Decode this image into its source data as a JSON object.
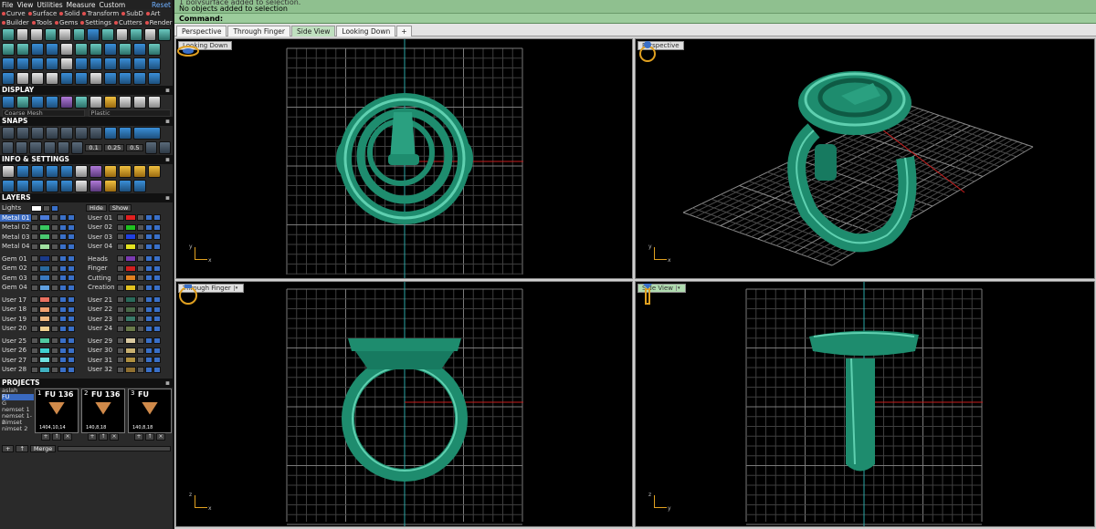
{
  "menu": [
    "File",
    "View",
    "Utilities",
    "Measure",
    "Custom"
  ],
  "menu_reset": "Reset",
  "categories": [
    "Curve",
    "Surface",
    "Solid",
    "Transform",
    "SubD",
    "Art",
    "Builder",
    "Tools",
    "Gems",
    "Settings",
    "Cutters",
    "Render"
  ],
  "sections": {
    "display": "DISPLAY",
    "snaps": "SNAPS",
    "info": "INFO & SETTINGS",
    "layers": "LAYERS",
    "projects": "PROJECTS"
  },
  "display_sub": [
    "Coarse Mesh",
    "Plastic"
  ],
  "snap_values": [
    "0.1",
    "0.25",
    "0.5"
  ],
  "layers": {
    "lights": "Lights",
    "hide": "Hide",
    "show": "Show",
    "left": [
      [
        {
          "name": "Metal 01",
          "color": "#4a7ad8",
          "sel": true
        },
        {
          "name": "Metal 02",
          "color": "#38c860"
        },
        {
          "name": "Metal 03",
          "color": "#4ac870"
        },
        {
          "name": "Metal 04",
          "color": "#a0e0a0"
        }
      ],
      [
        {
          "name": "Gem 01",
          "color": "#1a3a8a"
        },
        {
          "name": "Gem 02",
          "color": "#2a6aa0"
        },
        {
          "name": "Gem 03",
          "color": "#3a7ac0"
        },
        {
          "name": "Gem 04",
          "color": "#60a0e0"
        }
      ],
      [
        {
          "name": "User 17",
          "color": "#e87060"
        },
        {
          "name": "User 18",
          "color": "#f0a070"
        },
        {
          "name": "User 19",
          "color": "#f0b880"
        },
        {
          "name": "User 20",
          "color": "#f0d090"
        }
      ],
      [
        {
          "name": "User 25",
          "color": "#50c8a0"
        },
        {
          "name": "User 26",
          "color": "#40d0d0"
        },
        {
          "name": "User 27",
          "color": "#70e0e0"
        },
        {
          "name": "User 28",
          "color": "#40b0c0"
        }
      ]
    ],
    "right": [
      [
        {
          "name": "User 01",
          "color": "#e02020"
        },
        {
          "name": "User 02",
          "color": "#20c020"
        },
        {
          "name": "User 03",
          "color": "#2040e0"
        },
        {
          "name": "User 04",
          "color": "#e0e020"
        }
      ],
      [
        {
          "name": "Heads",
          "color": "#7a3ab0"
        },
        {
          "name": "Finger",
          "color": "#d02020"
        },
        {
          "name": "Cutting",
          "color": "#e08020"
        },
        {
          "name": "Creation",
          "color": "#e0c020"
        }
      ],
      [
        {
          "name": "User 21",
          "color": "#2a6a5a"
        },
        {
          "name": "User 22",
          "color": "#4a6a4a"
        },
        {
          "name": "User 23",
          "color": "#3a7a6a"
        },
        {
          "name": "User 24",
          "color": "#6a7a4a"
        }
      ],
      [
        {
          "name": "User 29",
          "color": "#d8c8a0"
        },
        {
          "name": "User 30",
          "color": "#c8b070"
        },
        {
          "name": "User 31",
          "color": "#b09040"
        },
        {
          "name": "User 32",
          "color": "#907030"
        }
      ]
    ]
  },
  "projects": {
    "list": [
      "aslah",
      "FU",
      "G",
      "nemset 1",
      "nemset 1-2",
      "nimset",
      "nimset 2"
    ],
    "thumbs": [
      {
        "num": "1",
        "title": "FU 136",
        "caption": "1404,10,14"
      },
      {
        "num": "2",
        "title": "FU 136",
        "caption": "140,8,18"
      },
      {
        "num": "3",
        "title": "FU",
        "caption": "140,8,18"
      }
    ],
    "merge": "Merge"
  },
  "command": {
    "line1": "1 polysurface added to selection.",
    "line2": "No objects added to selection",
    "prompt": "Command:"
  },
  "tabs": [
    "Perspective",
    "Through Finger",
    "Side View",
    "Looking Down",
    "+"
  ],
  "active_tab": "Side View",
  "viewports": {
    "tl": {
      "label": "Looking Down",
      "ax1": "y",
      "ax2": "x"
    },
    "tr": {
      "label": "Perspective",
      "ax1": "y",
      "ax2": "x"
    },
    "bl": {
      "label": "Through Finger",
      "ax1": "z",
      "ax2": "x"
    },
    "br": {
      "label": "Side View",
      "ax1": "z",
      "ax2": "y"
    }
  },
  "colors": {
    "ring_green": "#1e8c6e",
    "ring_highlight": "#5fd0b0",
    "grid": "#5a5a5a",
    "axis_red": "#c81e1e",
    "axis_teal": "#2aa6a6",
    "active_label": "#b0dcb0"
  },
  "icons": [
    "ring-icon",
    "menu-icon",
    "dropdown-icon",
    "close-icon"
  ]
}
